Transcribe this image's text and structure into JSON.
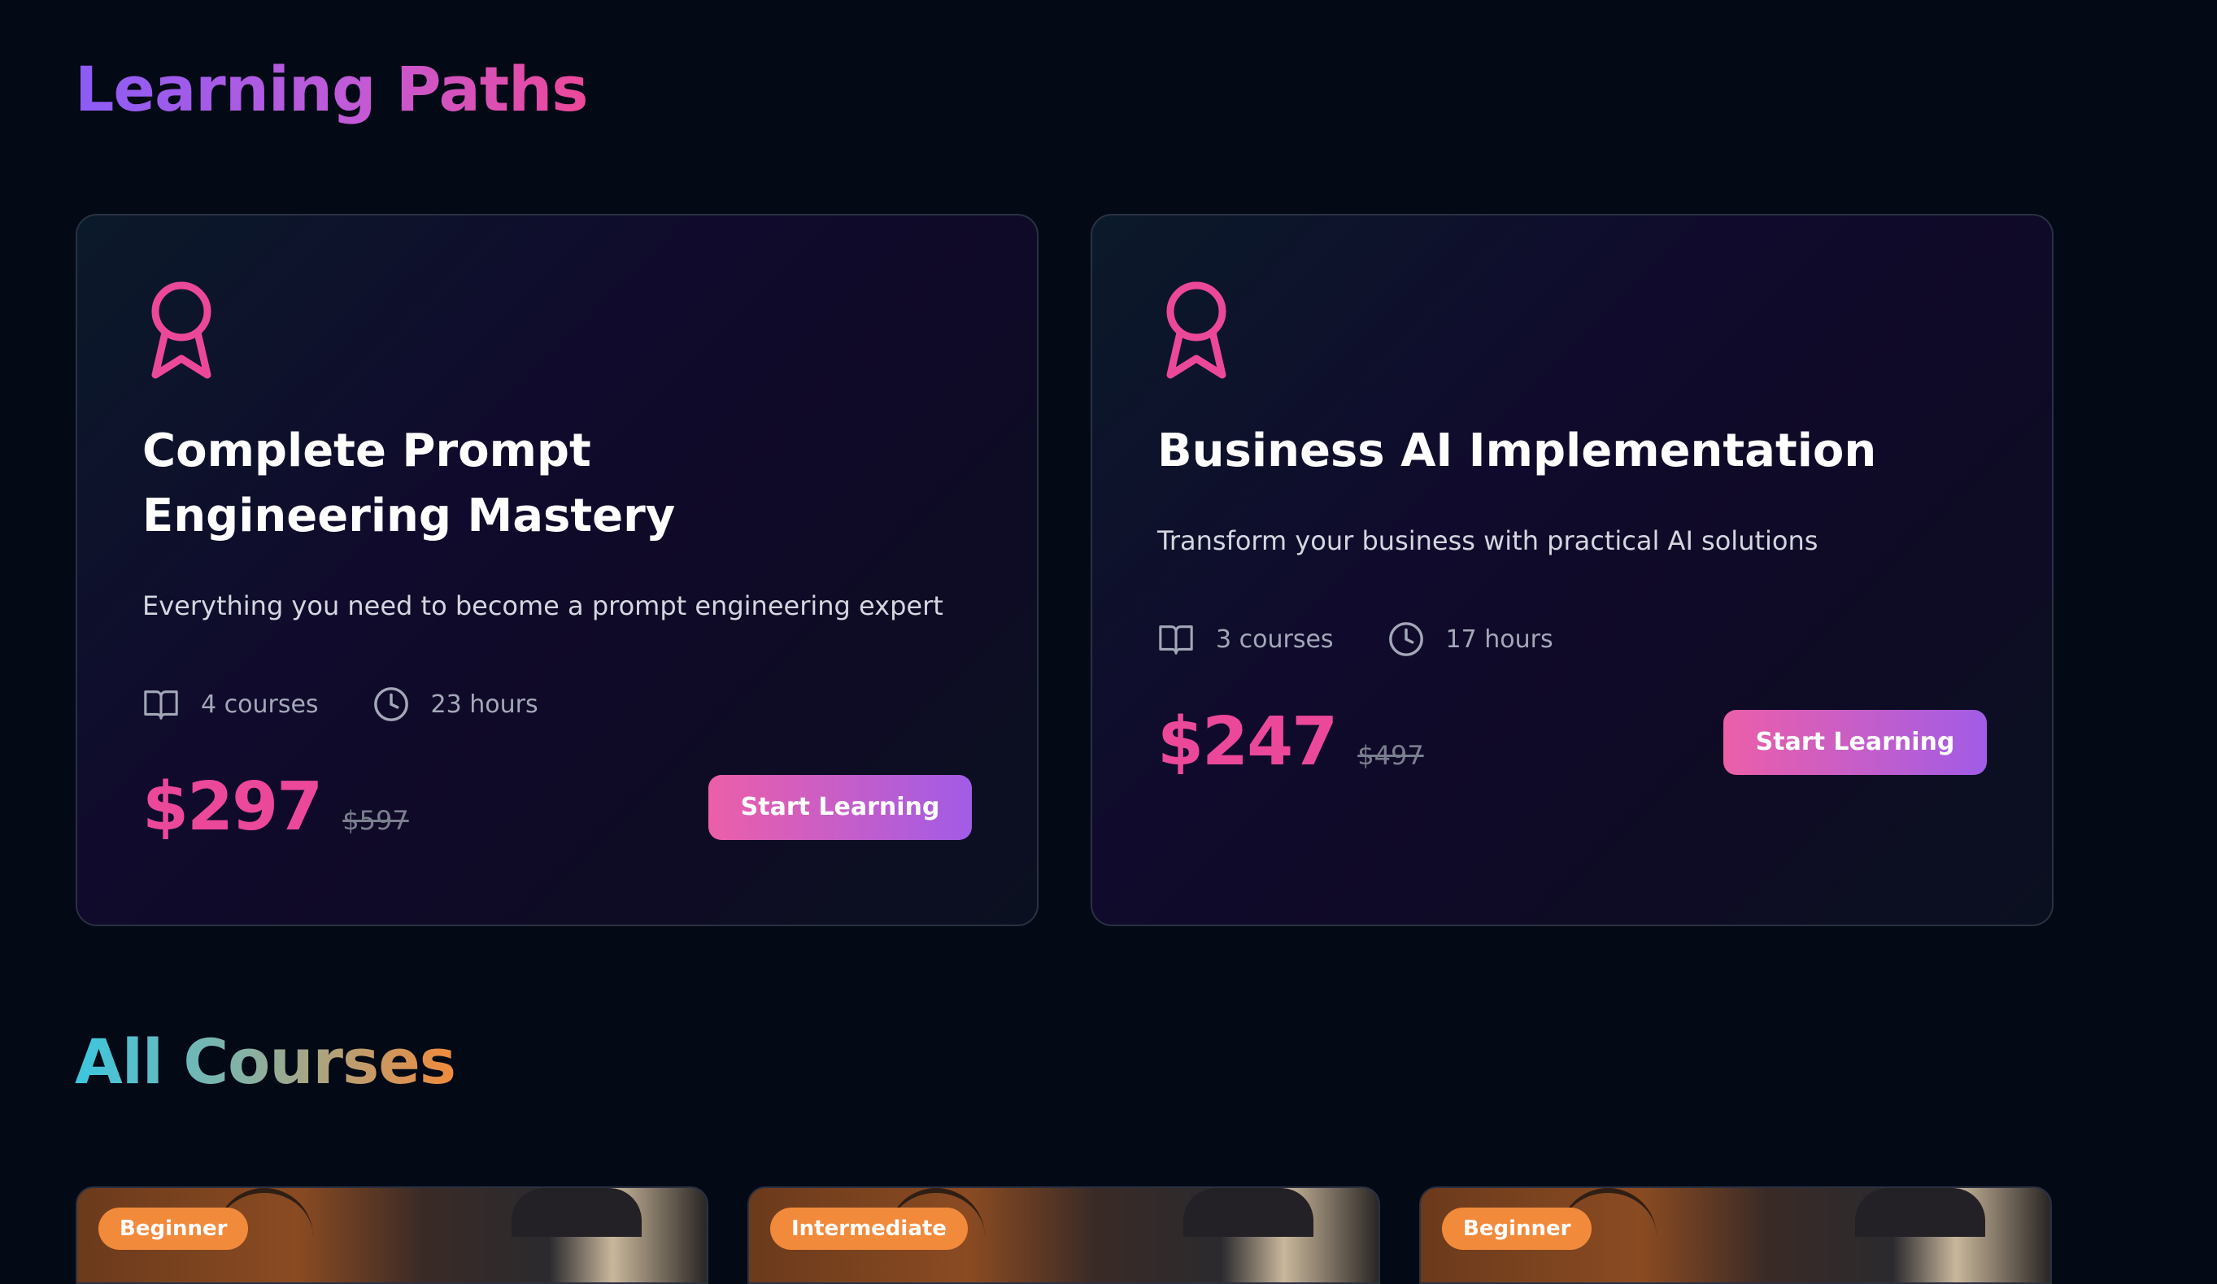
{
  "learning_paths": {
    "title": "Learning Paths",
    "cards": [
      {
        "icon": "award-icon",
        "title": "Complete Prompt Engineering Mastery",
        "description": "Everything you need to become a prompt engineering expert",
        "courses": "4 courses",
        "hours": "23 hours",
        "price": "$297",
        "old_price": "$597",
        "button_label": "Start Learning"
      },
      {
        "icon": "award-icon",
        "title": "Business AI Implementation",
        "description": "Transform your business with practical AI solutions",
        "courses": "3 courses",
        "hours": "17 hours",
        "price": "$247",
        "old_price": "$497",
        "button_label": "Start Learning"
      }
    ]
  },
  "all_courses": {
    "title": "All Courses",
    "cards": [
      {
        "level": "Beginner"
      },
      {
        "level": "Intermediate"
      },
      {
        "level": "Beginner"
      }
    ]
  },
  "colors": {
    "background": "#030915",
    "accent_pink": "#ec4899",
    "accent_purple": "#8b5cf6",
    "badge_orange": "#f28a3c"
  }
}
